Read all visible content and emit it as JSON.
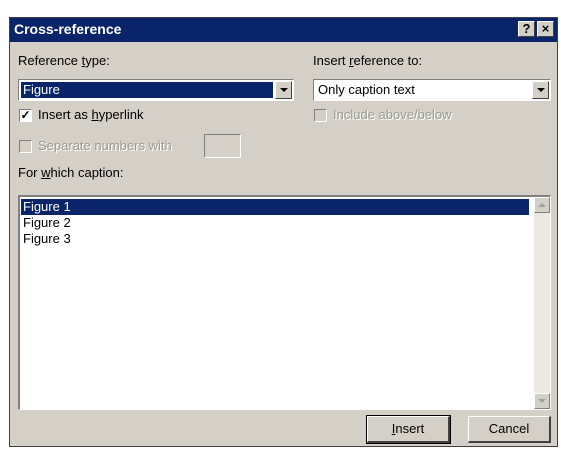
{
  "window": {
    "title": "Cross-reference",
    "help_label": "?",
    "close_label": "×"
  },
  "reference_type": {
    "label_pre": "Reference ",
    "label_key": "t",
    "label_post": "ype:",
    "value": "Figure"
  },
  "insert_reference_to": {
    "label_pre": "Insert ",
    "label_key": "r",
    "label_post": "eference to:",
    "value": "Only caption text"
  },
  "options": {
    "hyperlink": {
      "checked": true,
      "check_glyph": "✓",
      "label_pre": "Insert as ",
      "label_key": "h",
      "label_post": "yperlink"
    },
    "include_above_below": {
      "checked": false,
      "label": "Include above/below",
      "enabled": false
    },
    "separate_numbers": {
      "checked": false,
      "label": "Separate numbers with",
      "enabled": false,
      "value": ""
    }
  },
  "caption_list": {
    "label_pre": "For ",
    "label_key": "w",
    "label_post": "hich caption:",
    "items": [
      "Figure 1",
      "Figure 2",
      "Figure 3"
    ],
    "selected_index": 0
  },
  "buttons": {
    "insert_key": "I",
    "insert_rest": "nsert",
    "cancel": "Cancel"
  },
  "colors": {
    "titlebar": "#0a246a",
    "dialog_face": "#d4d0c8",
    "selection": "#0a246a"
  }
}
